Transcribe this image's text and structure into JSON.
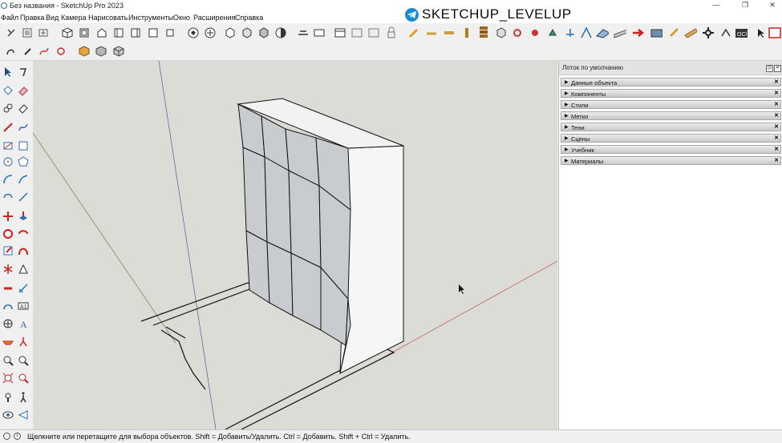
{
  "window": {
    "title": "Без названия - SketchUp Pro 2023",
    "controls": [
      "—",
      "❐",
      "✕"
    ]
  },
  "menu": {
    "items": [
      "Файл",
      "Правка",
      "Вид",
      "Камера",
      "Нарисовать",
      "Инструменты",
      "Окно",
      "Расширения",
      "Справка"
    ]
  },
  "watermark": {
    "text": "SKETCHUP_LEVELUP"
  },
  "tray": {
    "title": "Лоток по умолчанию",
    "pin": "⊡",
    "close": "✕",
    "panels": [
      "Данные объекта",
      "Компоненты",
      "Стили",
      "Метки",
      "Тени",
      "Сцены",
      "Учебник",
      "Материалы"
    ]
  },
  "status": {
    "text": "Щелкните или перетащите для выбора объектов. Shift = Добавить/Удалить. Ctrl = Добавить. Shift + Ctrl = Удалить."
  },
  "colors": {
    "viewport_bg": "#dcdcd7",
    "model_face": "#c9cccf",
    "model_side": "#f4f4f4",
    "axis_red": "#b63b3b",
    "axis_green": "#5c8a4b",
    "accent_blue": "#1b8ad3"
  }
}
